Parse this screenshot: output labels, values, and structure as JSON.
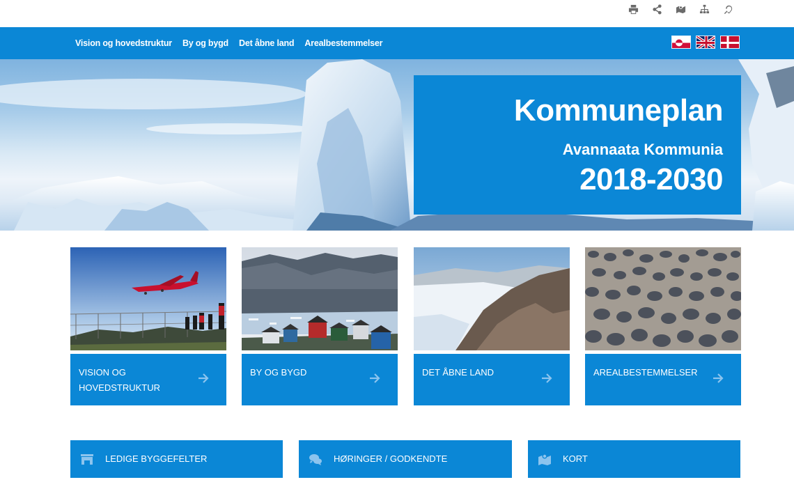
{
  "utility_icons": [
    "print-icon",
    "share-icon",
    "map-icon",
    "sitemap-icon",
    "hearing-icon"
  ],
  "nav": {
    "links": [
      "Vision og hovedstruktur",
      "By og bygd",
      "Det åbne land",
      "Arealbestemmelser"
    ],
    "flags": [
      "greenland-flag",
      "uk-flag",
      "denmark-flag"
    ]
  },
  "hero": {
    "title": "Kommuneplan",
    "subtitle": "Avannaata Kommunia",
    "years": "2018-2030"
  },
  "cards": [
    {
      "label": "VISION OG HOVEDSTRUKTUR",
      "image": "airplane-photo"
    },
    {
      "label": "BY OG BYGD",
      "image": "town-photo"
    },
    {
      "label": "DET ÅBNE LAND",
      "image": "glacier-photo"
    },
    {
      "label": "AREALBESTEMMELSER",
      "image": "stones-photo"
    }
  ],
  "quick_links": [
    {
      "label": "LEDIGE BYGGEFELTER",
      "icon": "store-icon"
    },
    {
      "label": "HØRINGER / GODKENDTE",
      "icon": "comments-icon"
    },
    {
      "label": "KORT",
      "icon": "map-icon"
    }
  ],
  "colors": {
    "accent": "#0b87d6",
    "icon_tint": "#8cc4ee"
  }
}
